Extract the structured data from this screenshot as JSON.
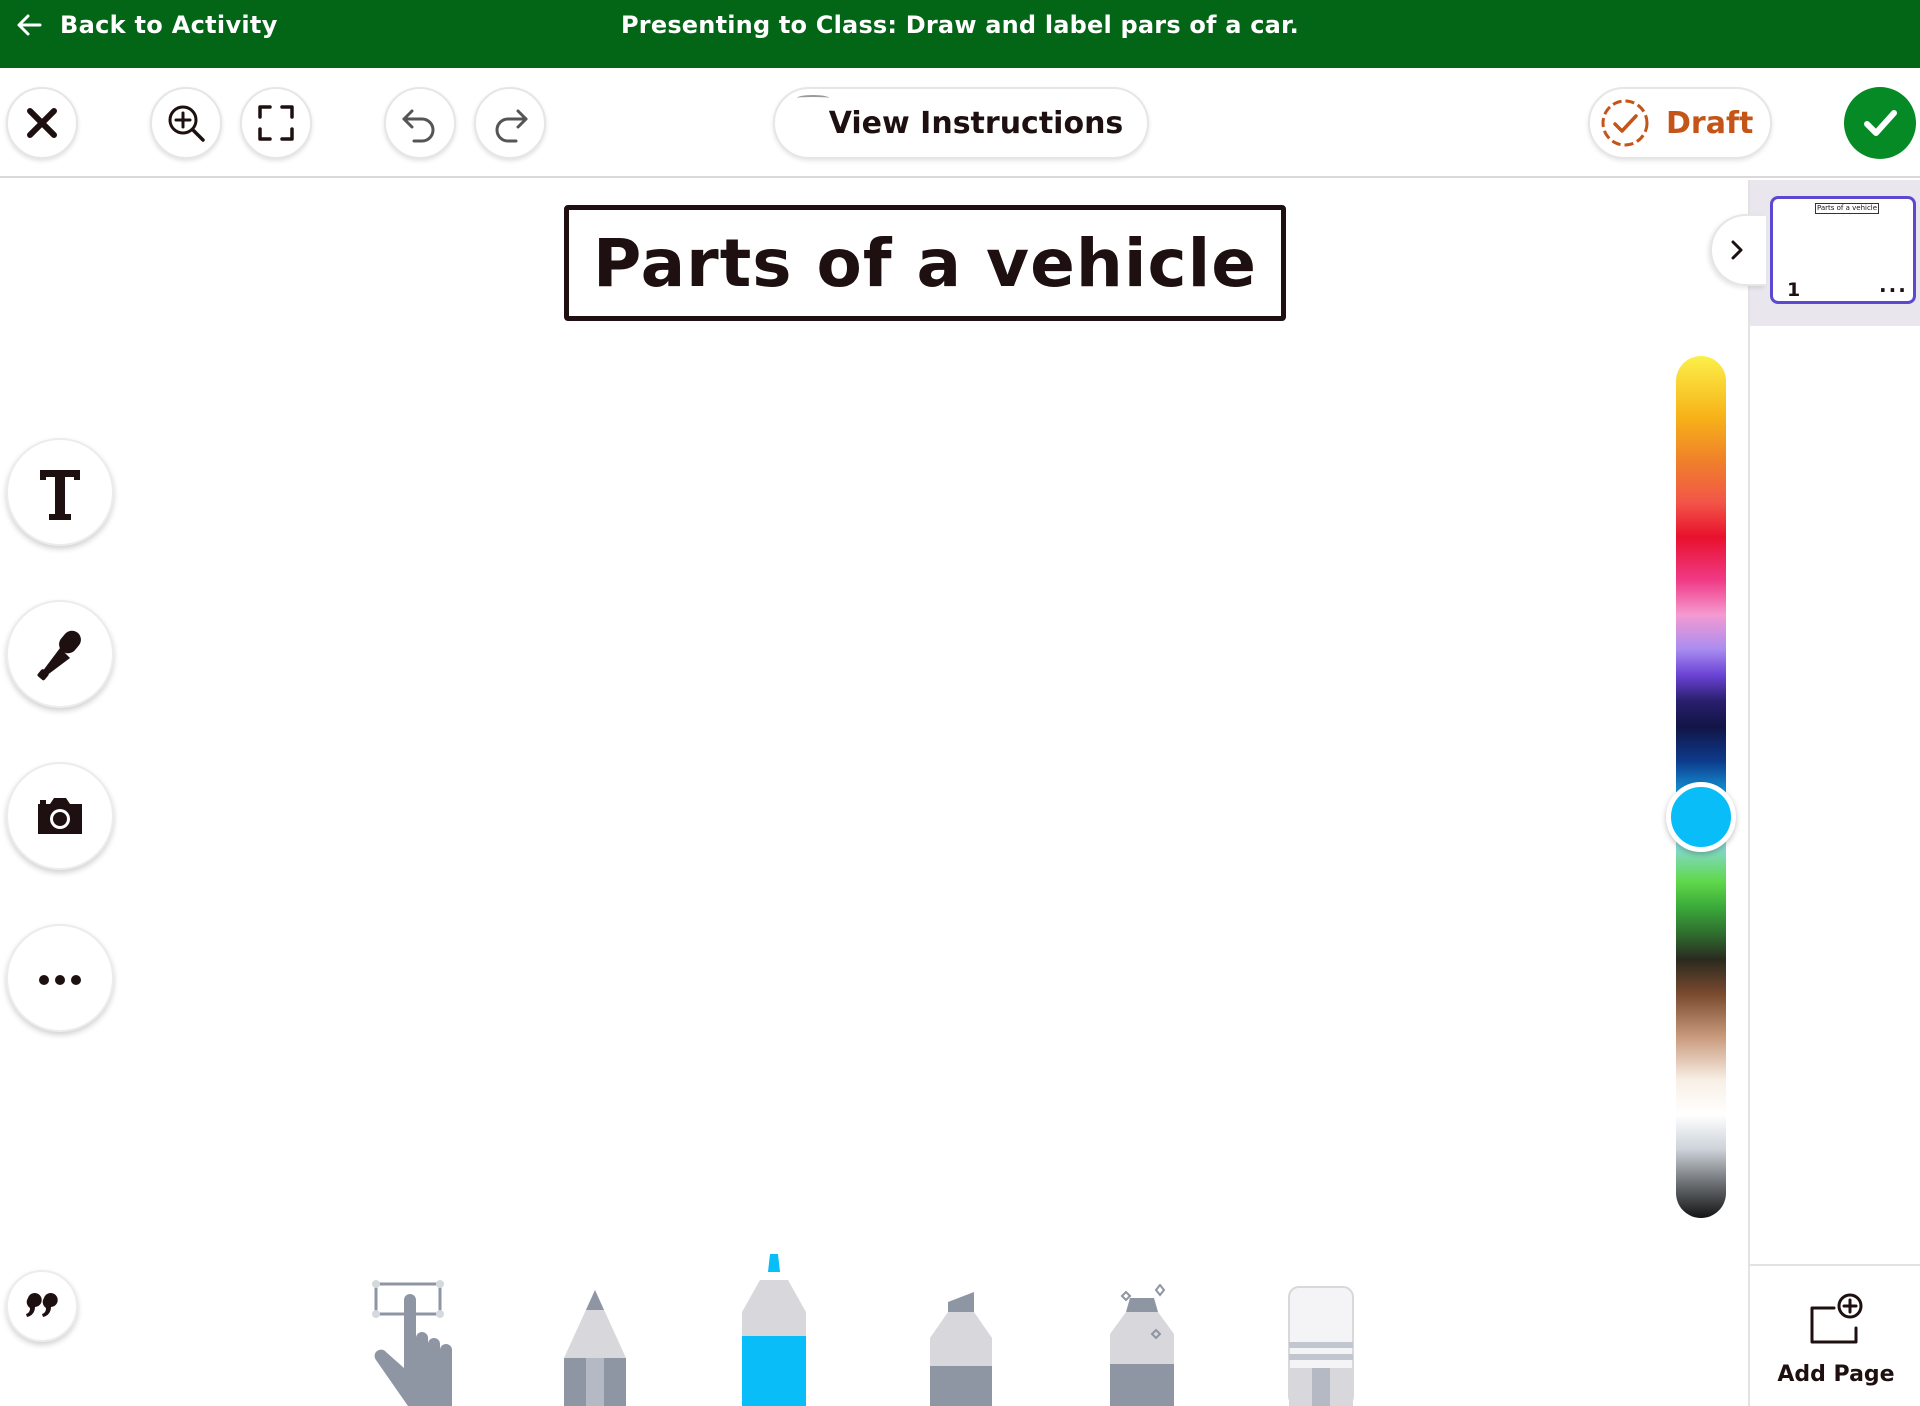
{
  "banner": {
    "back_label": "Back to Activity",
    "title": "Presenting to Class: Draw and label pars of a car."
  },
  "toolbar": {
    "view_instructions_label": "View Instructions",
    "draft_label": "Draft"
  },
  "canvas": {
    "title_text": "Parts of a vehicle"
  },
  "color_picker": {
    "selected_color": "#08bdf8"
  },
  "pages": {
    "thumbnail_title": "Parts of a vehicle",
    "page_number": "1",
    "menu_glyph": "...",
    "add_page_label": "Add Page"
  },
  "colors": {
    "banner": "#036617",
    "done": "#068a26",
    "draft": "#c45418",
    "page_selected_border": "#5b4ad1"
  }
}
